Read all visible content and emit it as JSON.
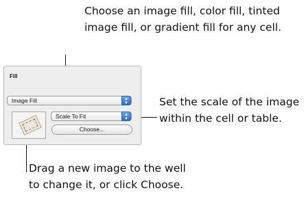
{
  "callouts": {
    "top": "Choose an image fill, color fill, tinted image fill, or gradient fill for any cell.",
    "right": "Set the scale of the image within the cell or table.",
    "bottom": "Drag a new image to the well to change it, or click Choose."
  },
  "panel": {
    "title": "Fill",
    "fill_popup_value": "Image Fill",
    "scale_popup_value": "Scale To Fit",
    "choose_button": "Choose..."
  },
  "icons": {
    "popup_arrows": "up-down-arrows-icon",
    "well_image": "ticket-image-icon"
  }
}
